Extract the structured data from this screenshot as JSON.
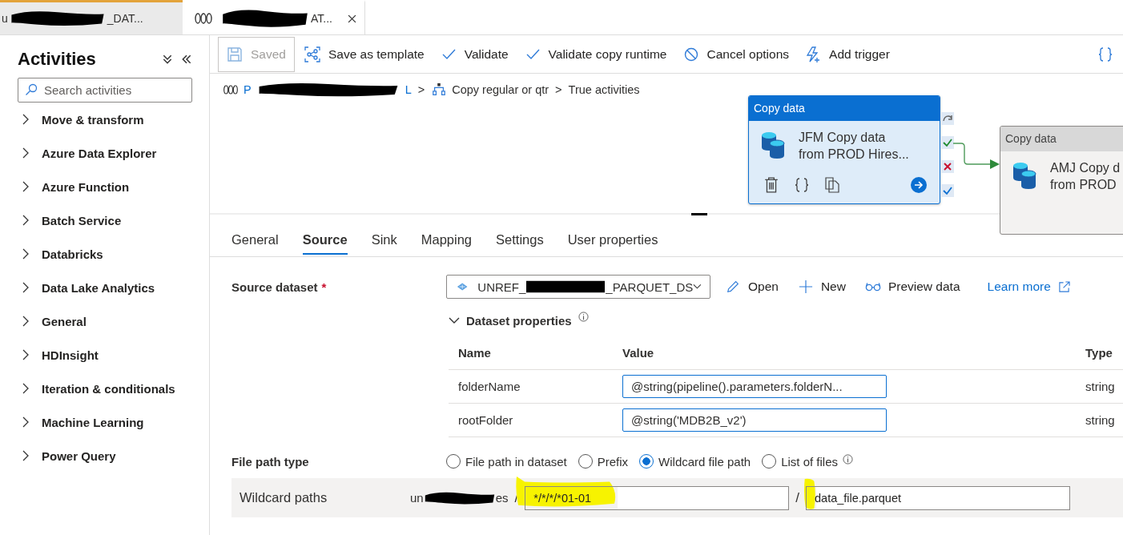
{
  "tabs": [
    {
      "prefix": "u",
      "suffix": "_DAT...",
      "selected": false,
      "closable": false
    },
    {
      "suffix": "AT...",
      "selected": true,
      "closable": true
    }
  ],
  "sidebar": {
    "title": "Activities",
    "search": {
      "placeholder": "Search activities"
    },
    "items": [
      {
        "label": "Move & transform",
        "expanded": false
      },
      {
        "label": "Azure Data Explorer",
        "expanded": false
      },
      {
        "label": "Azure Function",
        "expanded": false
      },
      {
        "label": "Batch Service",
        "expanded": false
      },
      {
        "label": "Databricks",
        "expanded": false
      },
      {
        "label": "Data Lake Analytics",
        "expanded": false
      },
      {
        "label": "General",
        "expanded": false
      },
      {
        "label": "HDInsight",
        "expanded": false
      },
      {
        "label": "Iteration & conditionals",
        "expanded": false
      },
      {
        "label": "Machine Learning",
        "expanded": false
      },
      {
        "label": "Power Query",
        "expanded": false
      }
    ]
  },
  "toolbar": [
    {
      "kind": "save",
      "label": "Saved",
      "disabled": true
    },
    {
      "kind": "template",
      "label": "Save as template",
      "disabled": false
    },
    {
      "kind": "check",
      "label": "Validate",
      "disabled": false
    },
    {
      "kind": "check",
      "label": "Validate copy runtime",
      "disabled": false
    },
    {
      "kind": "cancel",
      "label": "Cancel options",
      "disabled": false
    },
    {
      "kind": "trigger",
      "label": "Add trigger",
      "disabled": false
    }
  ],
  "breadcrumb": [
    {
      "kind": "pipeline",
      "prefix": "P",
      "suffix": "L",
      "separator": ">"
    },
    {
      "kind": "condition",
      "label": "Copy regular or qtr",
      "separator": ">"
    },
    {
      "kind": "plain",
      "label": "True activities"
    }
  ],
  "canvas": {
    "activities": [
      {
        "type": "Copy data",
        "name_lines": [
          "JFM Copy data",
          "from PROD Hires..."
        ],
        "selected": true
      },
      {
        "type": "Copy data",
        "name_lines": [
          "AMJ Copy d",
          "from PROD"
        ],
        "selected": false
      }
    ]
  },
  "detail_tabs": [
    {
      "label": "General",
      "selected": false
    },
    {
      "label": "Source",
      "selected": true
    },
    {
      "label": "Sink",
      "selected": false
    },
    {
      "label": "Mapping",
      "selected": false
    },
    {
      "label": "Settings",
      "selected": false
    },
    {
      "label": "User properties",
      "selected": false
    }
  ],
  "source_dataset": {
    "label": "Source dataset",
    "required": true,
    "required_mark": "*",
    "prefix": "UNREF_",
    "suffix": "_PARQUET_DS",
    "actions": [
      {
        "kind": "open",
        "label": "Open"
      },
      {
        "kind": "new",
        "label": "New"
      },
      {
        "kind": "preview",
        "label": "Preview data"
      },
      {
        "kind": "link",
        "label": "Learn more"
      }
    ]
  },
  "dataset_properties": {
    "title": "Dataset properties",
    "expanded": true,
    "columns": [
      "Name",
      "Value",
      "Type"
    ],
    "rows": [
      {
        "name": "folderName",
        "value": "@string(pipeline().parameters.folderN...",
        "type": "string"
      },
      {
        "name": "rootFolder",
        "value": "@string('MDB2B_v2')",
        "type": "string"
      }
    ]
  },
  "file_path_type": {
    "label": "File path type",
    "options": [
      {
        "label": "File path in dataset",
        "selected": false,
        "info": false
      },
      {
        "label": "Prefix",
        "selected": false,
        "info": false
      },
      {
        "label": "Wildcard file path",
        "selected": true,
        "info": false
      },
      {
        "label": "List of files",
        "selected": false,
        "info": true
      }
    ]
  },
  "wildcard_paths": {
    "label": "Wildcard paths",
    "prefix": "un",
    "suffix": "es",
    "separators": [
      "/",
      "/"
    ],
    "folder": {
      "value": "*/*/*/*01-01",
      "highlighted": true
    },
    "file": {
      "value": "data_file.parquet",
      "highlighted": true
    }
  }
}
